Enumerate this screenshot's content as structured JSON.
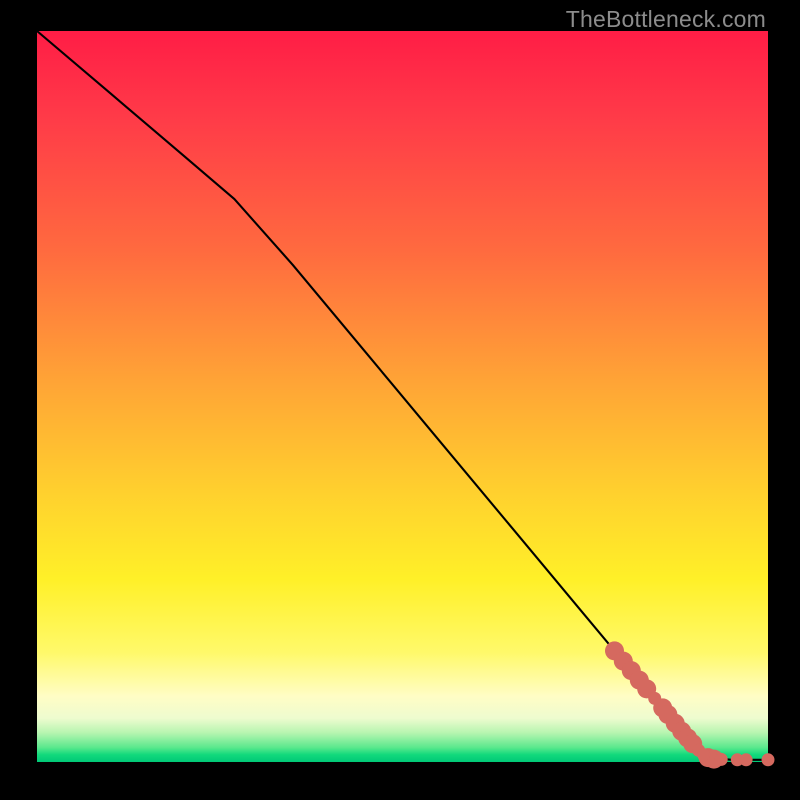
{
  "watermark": "TheBottleneck.com",
  "colors": {
    "frame": "#000000",
    "curve": "#000000",
    "marker": "#d5695f"
  },
  "chart_data": {
    "type": "line",
    "title": "",
    "xlabel": "",
    "ylabel": "",
    "xlim": [
      0,
      100
    ],
    "ylim": [
      0,
      100
    ],
    "grid": false,
    "legend": false,
    "curve": [
      {
        "x": 0,
        "y": 100.0
      },
      {
        "x": 10,
        "y": 91.5
      },
      {
        "x": 20,
        "y": 83.0
      },
      {
        "x": 27,
        "y": 77.0
      },
      {
        "x": 35,
        "y": 68.0
      },
      {
        "x": 45,
        "y": 56.0
      },
      {
        "x": 55,
        "y": 44.0
      },
      {
        "x": 65,
        "y": 32.0
      },
      {
        "x": 75,
        "y": 20.0
      },
      {
        "x": 85,
        "y": 8.0
      },
      {
        "x": 90,
        "y": 2.0
      },
      {
        "x": 92,
        "y": 0.6
      },
      {
        "x": 95,
        "y": 0.3
      },
      {
        "x": 100,
        "y": 0.3
      }
    ],
    "markers_large": [
      {
        "x": 79.0,
        "y": 15.2
      },
      {
        "x": 80.2,
        "y": 13.8
      },
      {
        "x": 81.3,
        "y": 12.5
      },
      {
        "x": 82.4,
        "y": 11.2
      },
      {
        "x": 83.4,
        "y": 10.0
      },
      {
        "x": 85.6,
        "y": 7.4
      },
      {
        "x": 86.3,
        "y": 6.5
      },
      {
        "x": 87.3,
        "y": 5.3
      },
      {
        "x": 88.2,
        "y": 4.2
      },
      {
        "x": 89.0,
        "y": 3.3
      },
      {
        "x": 89.7,
        "y": 2.5
      },
      {
        "x": 91.8,
        "y": 0.6
      },
      {
        "x": 92.6,
        "y": 0.4
      }
    ],
    "markers_small": [
      {
        "x": 84.5,
        "y": 8.7
      },
      {
        "x": 90.5,
        "y": 1.6
      },
      {
        "x": 91.2,
        "y": 1.0
      },
      {
        "x": 93.6,
        "y": 0.35
      },
      {
        "x": 95.8,
        "y": 0.3
      },
      {
        "x": 97.0,
        "y": 0.3
      },
      {
        "x": 100.0,
        "y": 0.3
      }
    ]
  }
}
